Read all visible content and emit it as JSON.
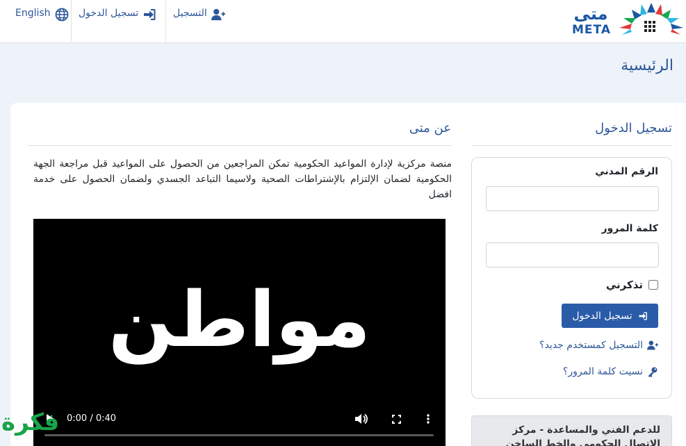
{
  "nav": {
    "english": "English",
    "login": "تسجيل الدخول",
    "register": "التسجيل"
  },
  "logo": {
    "arabic": "متى",
    "latin": "META"
  },
  "breadcrumb": "الرئيسية",
  "login_section": {
    "heading": "تسجيل الدخول",
    "civil_id_label": "الرقم المدني",
    "password_label": "كلمة المرور",
    "remember_label": "تذكرني",
    "submit_label": "تسجيل الدخول",
    "register_link": "التسجيل كمستخدم جديد؟",
    "forgot_link": "نسيت كلمة المرور؟"
  },
  "about_section": {
    "heading": "عن متى",
    "description": "منصة مركزية لإدارة المواعيد الحكومية تمكن المراجعين من الحصول على المواعيد قبل مراجعة الجهة الحكومية لضمان الإلتزام بالإشتراطات الصحية ولاسيما التباعد الجسدي ولضمان الحصول على خدمة افضل"
  },
  "video": {
    "overlay_word": "مواطن",
    "time": "0:00 / 0:40"
  },
  "support": {
    "text": "للدعم الفني والمساعدة - مركز الاتصال الحكومي والخط الساخن"
  },
  "watermark": "فكرة",
  "colors": {
    "brand_blue": "#2c5697",
    "button_blue": "#2a5ba8",
    "page_bg": "#eef3fa"
  },
  "icons": {
    "english": "globe-icon",
    "login": "sign-in-icon",
    "register": "user-plus-icon",
    "forgot": "key-icon"
  }
}
